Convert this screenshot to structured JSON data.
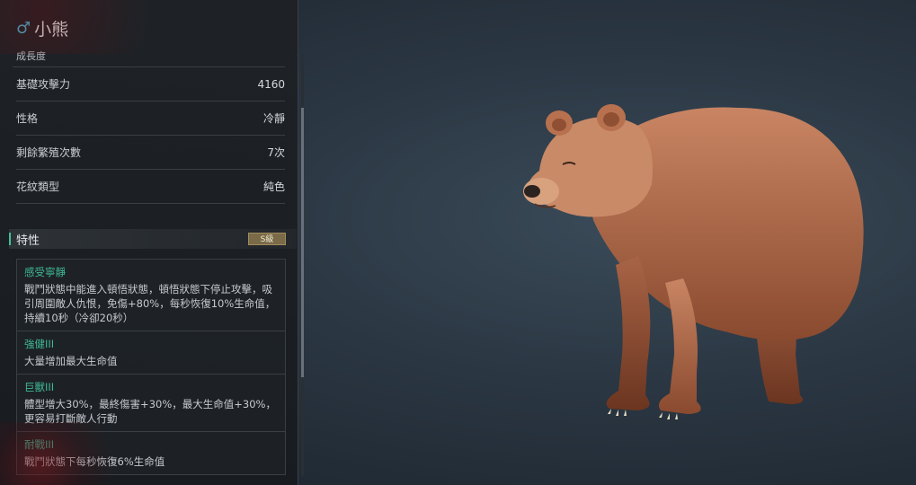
{
  "creature": {
    "gender_icon": "male-icon",
    "gender_symbol": "♂",
    "name": "小熊",
    "growth_label": "成長度"
  },
  "stats": [
    {
      "label": "基礎攻擊力",
      "value": "4160"
    },
    {
      "label": "性格",
      "value": "冷靜"
    },
    {
      "label": "剩餘繁殖次數",
      "value": "7次"
    },
    {
      "label": "花紋類型",
      "value": "純色"
    }
  ],
  "traits": {
    "title": "特性",
    "rank": "S級",
    "items": [
      {
        "name": "感受寧靜",
        "desc": "戰鬥狀態中能進入頓悟狀態，頓悟狀態下停止攻擊，吸引周圍敵人仇恨，免傷+80%，每秒恢復10%生命值，持續10秒（冷卻20秒）"
      },
      {
        "name": "強健III",
        "desc": "大量增加最大生命值"
      },
      {
        "name": "巨獸III",
        "desc": "體型增大30%，最終傷害+30%，最大生命值+30%，更容易打斷敵人行動"
      },
      {
        "name": "耐戰III",
        "desc": "戰鬥狀態下每秒恢復6%生命值"
      }
    ]
  },
  "colors": {
    "accent": "#3fb894",
    "gender": "#4fb4d6",
    "badge": "#7a6a48"
  }
}
